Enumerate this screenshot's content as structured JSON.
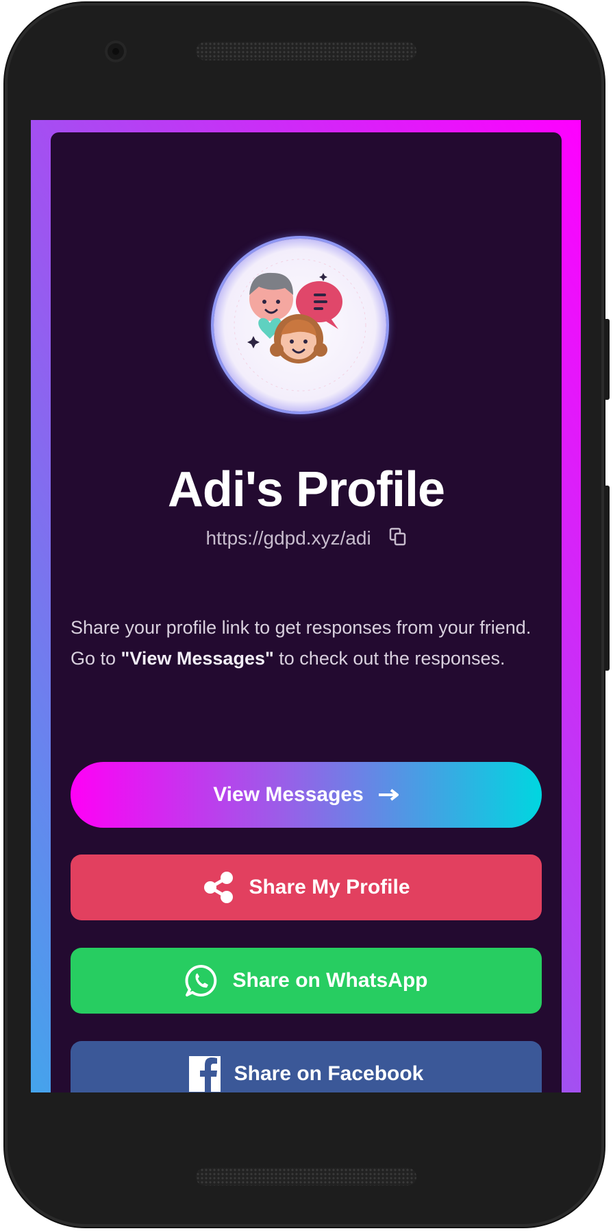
{
  "profile": {
    "title": "Adi's Profile",
    "link": "https://gdpd.xyz/adi",
    "description_start": "Share your profile link to get responses from your friend. Go to ",
    "description_bold": "\"View Messages\"",
    "description_end": " to check out the responses."
  },
  "buttons": {
    "view_messages": "View Messages",
    "share_profile": "Share My Profile",
    "share_whatsapp": "Share on WhatsApp",
    "share_facebook": "Share on Facebook"
  },
  "icons": {
    "copy": "copy-icon",
    "arrow": "arrow-right-icon",
    "share": "share-icon",
    "whatsapp": "whatsapp-icon",
    "facebook": "facebook-icon"
  },
  "colors": {
    "card_bg": "#230a30",
    "share_btn": "#e2405f",
    "whatsapp_btn": "#27cd61",
    "facebook_btn": "#3b5898",
    "gradient_start": "#ff00f6",
    "gradient_end": "#00d6e0"
  }
}
